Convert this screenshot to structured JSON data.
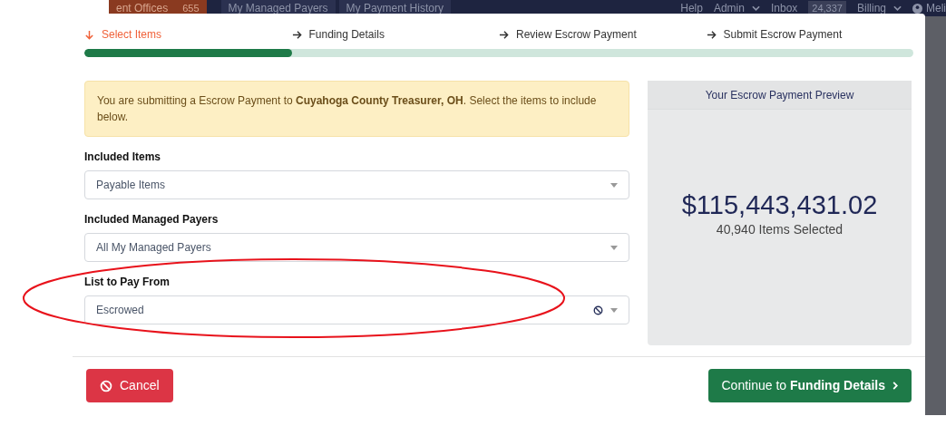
{
  "top_nav": {
    "left_items": [
      {
        "label": "ent Offices",
        "badge": "655"
      },
      {
        "label": "My Managed Payers"
      },
      {
        "label": "My Payment History"
      }
    ],
    "right_items": [
      {
        "label": "Help",
        "kind": "link"
      },
      {
        "label": "Admin",
        "kind": "dropdown"
      },
      {
        "label": "Inbox",
        "kind": "link"
      },
      {
        "label": "24,337",
        "kind": "count"
      },
      {
        "label": "Billing",
        "kind": "dropdown"
      },
      {
        "label": "Meli",
        "kind": "user"
      }
    ]
  },
  "stepper": {
    "steps": [
      {
        "label": "Select Items",
        "selected": true
      },
      {
        "label": "Funding Details",
        "selected": false
      },
      {
        "label": "Review Escrow Payment",
        "selected": false
      },
      {
        "label": "Submit Escrow Payment",
        "selected": false
      }
    ],
    "progress": {
      "level": 0.25
    }
  },
  "notice": "You are submitting a Escrow Payment to **Cuyahoga County Treasurer, OH**. Select the items to include below.",
  "fields": [
    {
      "label": "Included Items",
      "value": "Payable Items",
      "clearable": false
    },
    {
      "label": "Included Managed Payers",
      "value": "All My Managed Payers",
      "clearable": false
    },
    {
      "label": "List to Pay From",
      "value": "Escrowed",
      "clearable": true
    }
  ],
  "preview": {
    "title": "Your Escrow Payment Preview",
    "amount": "$115,443,431.02",
    "count": "40,940 Items Selected"
  },
  "buttons": {
    "cancel": "Cancel",
    "continue": "Continue to **Funding Details**"
  },
  "annotation": {
    "kind": "ellipse",
    "color": "#e8121b"
  }
}
